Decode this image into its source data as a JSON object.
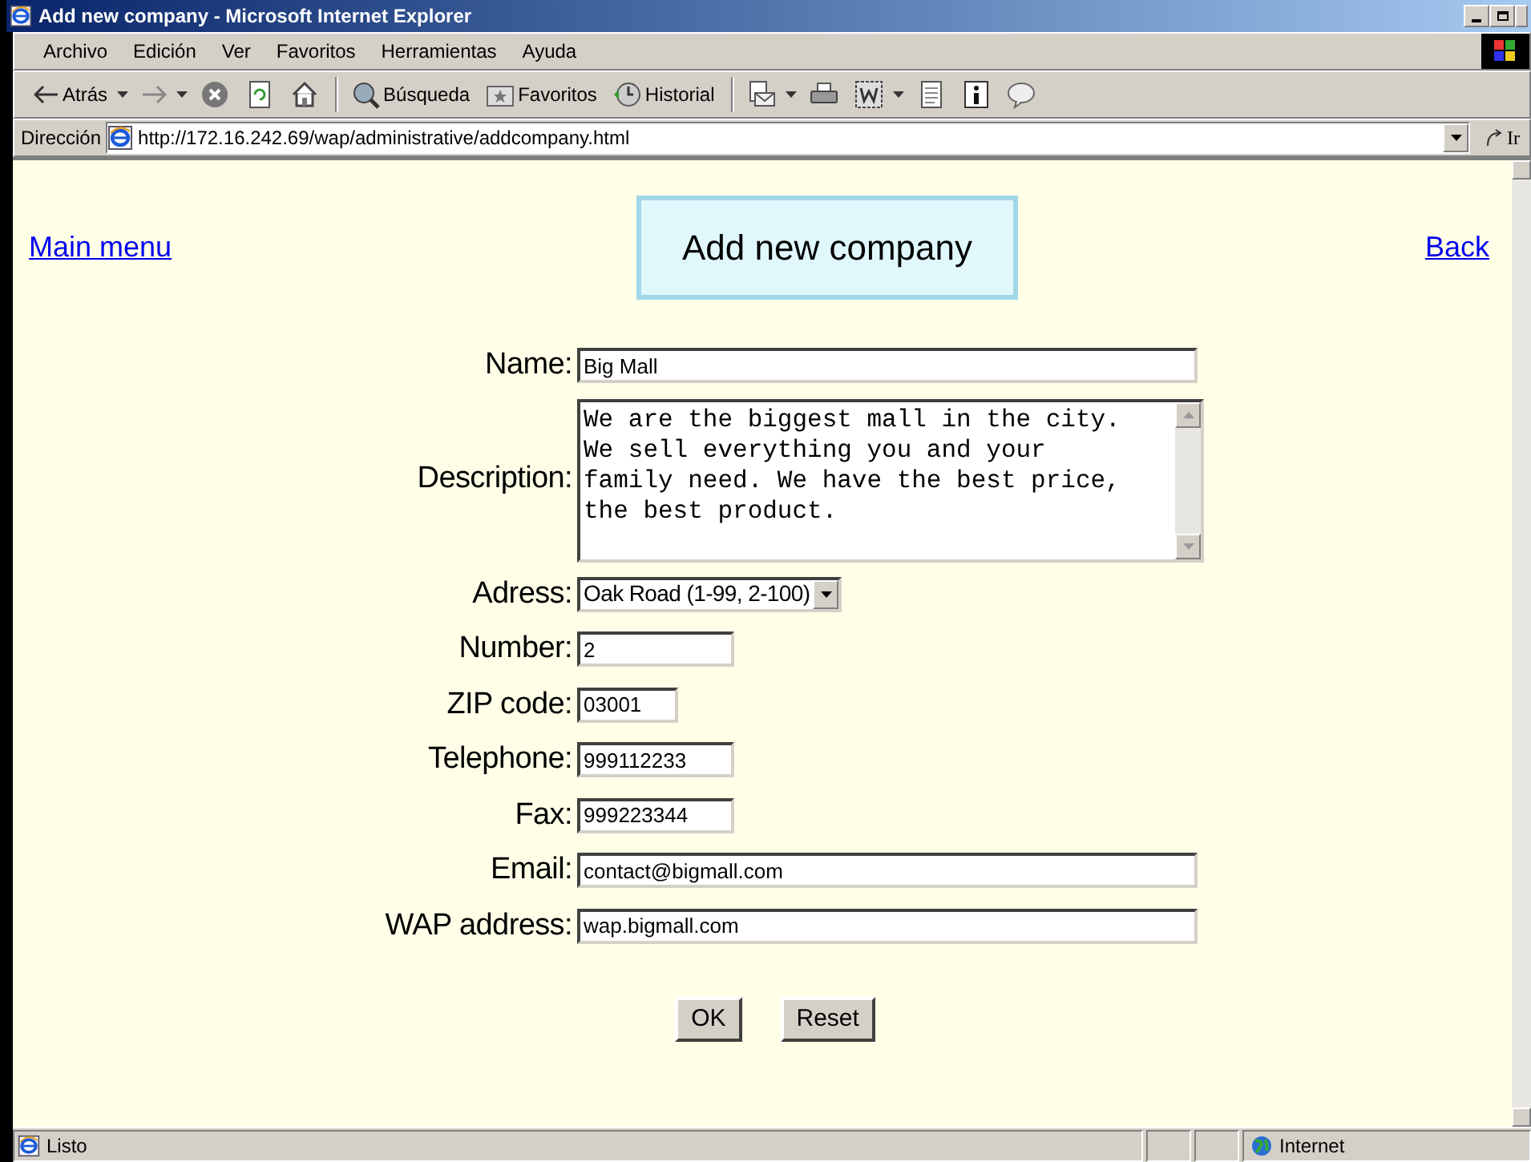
{
  "window": {
    "title": "Add new company - Microsoft Internet Explorer"
  },
  "menu": [
    "Archivo",
    "Edición",
    "Ver",
    "Favoritos",
    "Herramientas",
    "Ayuda"
  ],
  "toolbar": [
    {
      "kind": "back",
      "label": "Atrás",
      "dropdown": true
    },
    {
      "kind": "forward",
      "dropdown": true
    },
    {
      "kind": "stop",
      "dropdown": false
    },
    {
      "kind": "refresh",
      "dropdown": false
    },
    {
      "kind": "home",
      "dropdown": false
    },
    {
      "kind": "search",
      "label": "Búsqueda",
      "dropdown": false
    },
    {
      "kind": "favorites",
      "label": "Favoritos",
      "dropdown": false
    },
    {
      "kind": "history",
      "label": "Historial",
      "dropdown": false
    },
    {
      "kind": "mail",
      "dropdown": true
    },
    {
      "kind": "print",
      "dropdown": false
    },
    {
      "kind": "edit",
      "dropdown": true
    },
    {
      "kind": "page",
      "dropdown": false
    },
    {
      "kind": "info",
      "dropdown": false
    },
    {
      "kind": "discuss",
      "dropdown": false
    }
  ],
  "address_bar": {
    "label": "Dirección",
    "value": "http://172.16.242.69/wap/administrative/addcompany.html",
    "go": "Ir"
  },
  "page": {
    "left_link": "Main menu",
    "heading": "Add new company",
    "right_link": "Back",
    "fields": [
      {
        "label": "Name:",
        "kind": "text",
        "value": "Big Mall"
      },
      {
        "label": "Description:",
        "kind": "textarea",
        "value": "We are the biggest mall in the city. We sell everything you and your family need. We have the best price, the best product."
      },
      {
        "label": "Adress:",
        "kind": "select",
        "value": "Oak Road (1-99, 2-100)"
      },
      {
        "label": "Number:",
        "kind": "text",
        "value": "2"
      },
      {
        "label": "ZIP code:",
        "kind": "text",
        "value": "03001"
      },
      {
        "label": "Telephone:",
        "kind": "text",
        "value": "999112233"
      },
      {
        "label": "Fax:",
        "kind": "text",
        "value": "999223344"
      },
      {
        "label": "Email:",
        "kind": "text",
        "value": "contact@bigmall.com"
      },
      {
        "label": "WAP address:",
        "kind": "text",
        "value": "wap.bigmall.com"
      }
    ],
    "buttons": [
      "OK",
      "Reset"
    ]
  },
  "status_bar": {
    "text": "Listo",
    "zone": "Internet"
  }
}
